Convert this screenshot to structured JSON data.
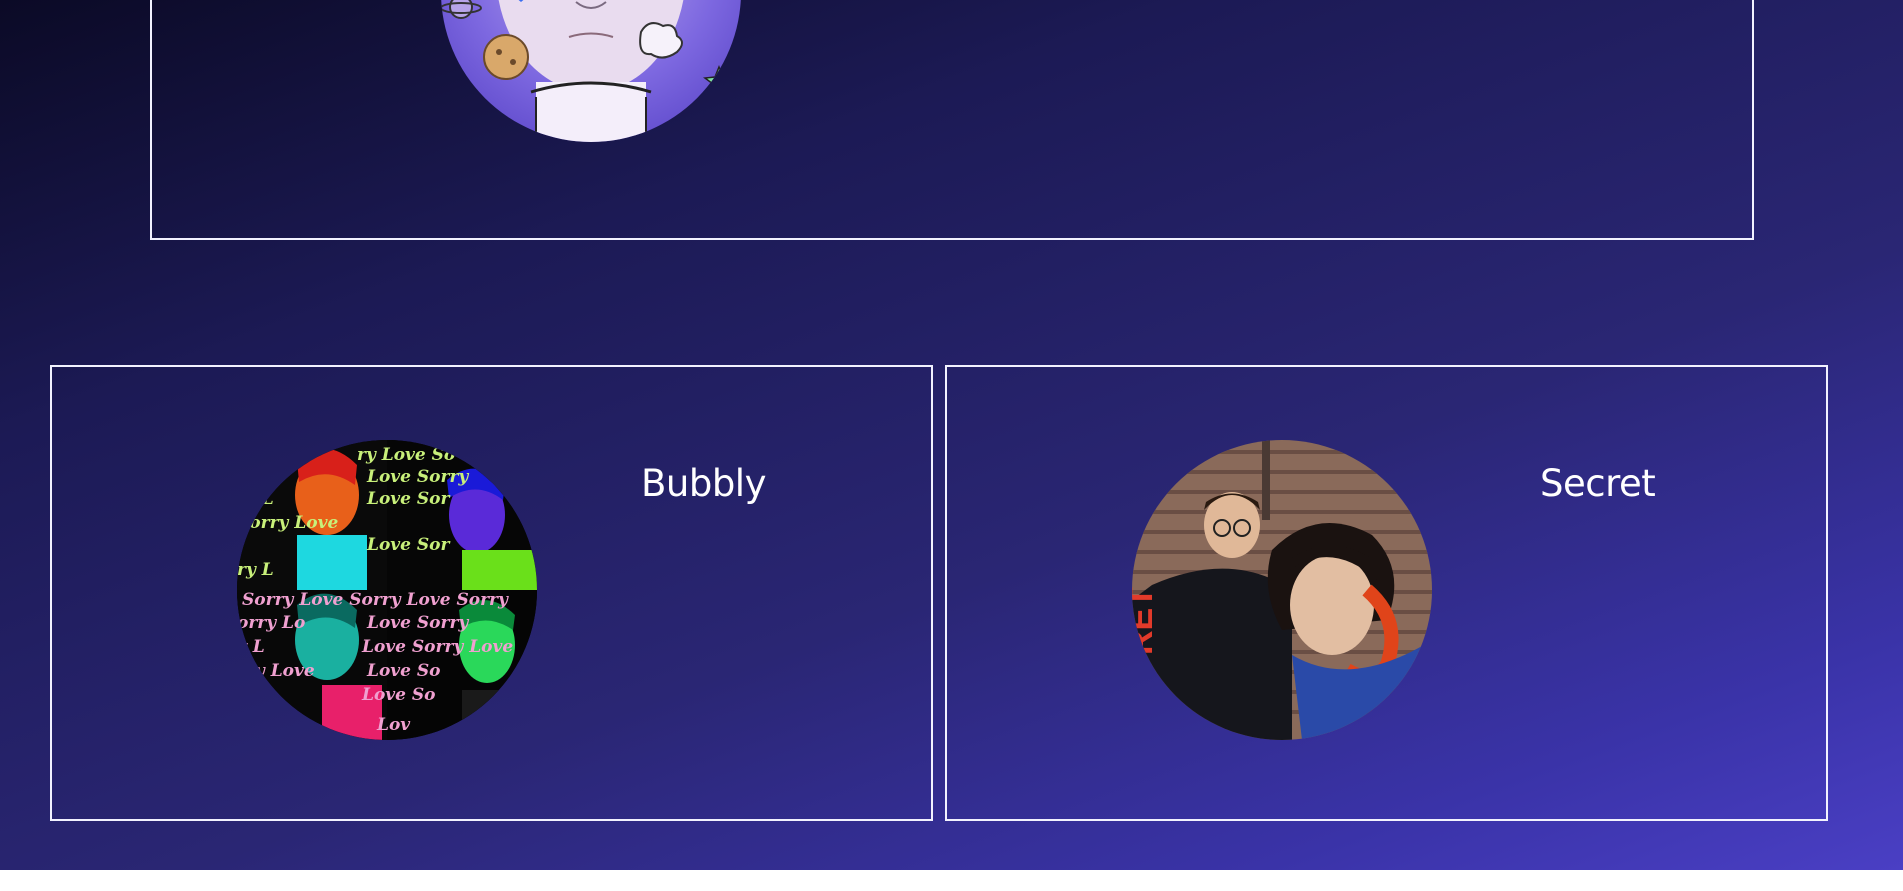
{
  "cards": [
    {
      "title": "",
      "avatar_icon": "illustrated-portrait-avatar"
    },
    {
      "title": "Bubbly",
      "avatar_icon": "pop-art-portrait-avatar",
      "background_text": "Sorry Love"
    },
    {
      "title": "Secret",
      "avatar_icon": "two-friends-photo-avatar",
      "background_text": "RET"
    }
  ],
  "colors": {
    "border": "#f2f2ff",
    "title": "#ffffff",
    "background_start": "#0b0a26",
    "background_end": "#4a3fc4"
  }
}
